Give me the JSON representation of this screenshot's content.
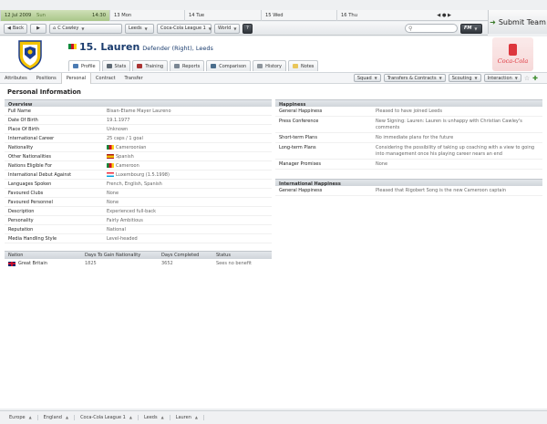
{
  "calendar": [
    {
      "date": "12 Jul 2009",
      "day": "Sun",
      "time": "14:30",
      "active": true
    },
    {
      "date": "13",
      "day": "Mon"
    },
    {
      "date": "14",
      "day": "Tue"
    },
    {
      "date": "15",
      "day": "Wed"
    },
    {
      "date": "16",
      "day": "Thu"
    }
  ],
  "calendar_controls": "◀ ● ▶",
  "submit_label": "Submit Team",
  "nav": {
    "back": "Back",
    "manager": "C Cawley",
    "team": "Leeds",
    "competition": "Coca-Cola League 1",
    "world": "World",
    "help": "?",
    "fm": "FM"
  },
  "player": {
    "number_name": "15. Lauren",
    "subtitle": "Defender (Right), Leeds"
  },
  "tabs": [
    "Profile",
    "Stats",
    "Training",
    "Reports",
    "Comparison",
    "History",
    "Notes"
  ],
  "subtabs": [
    "Attributes",
    "Positions",
    "Personal",
    "Contract",
    "Transfer"
  ],
  "menus": [
    "Squad",
    "Transfers & Contracts",
    "Scouting",
    "Interaction"
  ],
  "sponsor": "Coca-Cola",
  "page_title": "Personal Information",
  "overview": {
    "header": "Overview",
    "rows": [
      {
        "k": "Full Name",
        "v": "Bisan-Etame Mayer Laureno"
      },
      {
        "k": "Date Of Birth",
        "v": "19.1.1977"
      },
      {
        "k": "Place Of Birth",
        "v": "Unknown"
      },
      {
        "k": "International Career",
        "v": "25 caps / 1 goal"
      },
      {
        "k": "Nationality",
        "v": "Cameroonian",
        "flag": "cm"
      },
      {
        "k": "Other Nationalities",
        "v": "Spanish",
        "flag": "es"
      },
      {
        "k": "Nations Eligible For",
        "v": "Cameroon",
        "flag": "cm"
      },
      {
        "k": "International Debut Against",
        "v": "Luxembourg (1.5.1998)",
        "flag": "lu"
      },
      {
        "k": "Languages Spoken",
        "v": "French, English, Spanish"
      },
      {
        "k": "Favoured Clubs",
        "v": "None"
      },
      {
        "k": "Favoured Personnel",
        "v": "None"
      },
      {
        "k": "Description",
        "v": "Experienced full-back"
      },
      {
        "k": "Personality",
        "v": "Fairly Ambitious"
      },
      {
        "k": "Reputation",
        "v": "National"
      },
      {
        "k": "Media Handling Style",
        "v": "Level-headed"
      }
    ]
  },
  "nationality_table": {
    "headers": [
      "Nation",
      "Days To Gain Nationality",
      "Days Completed",
      "Status"
    ],
    "row": [
      "Great Britain",
      "1825",
      "3652",
      "Sees no benefit"
    ]
  },
  "happiness": {
    "header": "Happiness",
    "rows": [
      {
        "k": "General Happiness",
        "v": "Pleased to have joined Leeds"
      },
      {
        "k": "Press Conference",
        "v": "New Signing: Lauren: Lauren is unhappy with Christian Cawley's comments"
      },
      {
        "k": "Short-term Plans",
        "v": "No immediate plans for the future"
      },
      {
        "k": "Long-term Plans",
        "v": "Considering the possibility of taking up coaching with a view to going into management once his playing career nears an end"
      },
      {
        "k": "Manager Promises",
        "v": "None"
      }
    ]
  },
  "intl_happiness": {
    "header": "International Happiness",
    "rows": [
      {
        "k": "General Happiness",
        "v": "Pleased that Rigobert Song is the new Cameroon captain"
      }
    ]
  },
  "breadcrumbs": [
    "Europe",
    "England",
    "Coca-Cola League 1",
    "Leeds",
    "Lauren"
  ]
}
